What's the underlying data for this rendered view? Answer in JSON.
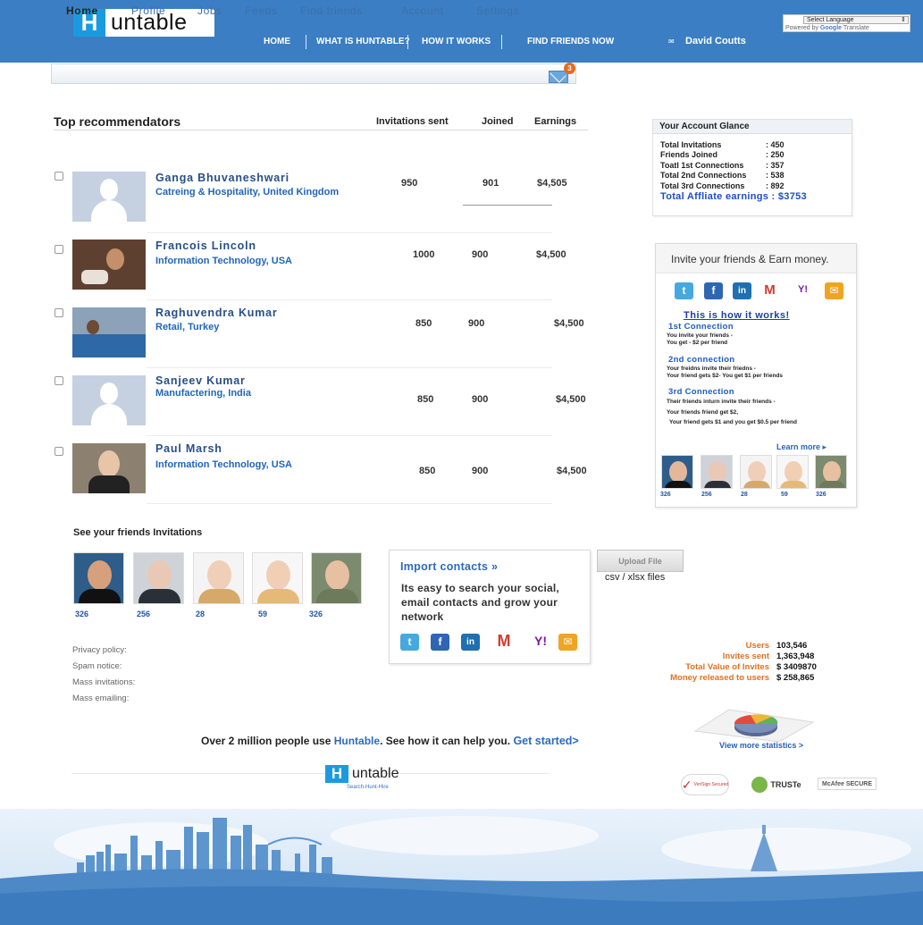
{
  "brand": {
    "logo_letter": "H",
    "logo_word": "untable",
    "footer_sub": "Search-Hunt-Hire"
  },
  "topnav": {
    "home": "HOME",
    "what": "WHAT IS HUNTABLE?",
    "how": "HOW IT WORKS",
    "find": "FIND FRIENDS NOW",
    "user": "David Coutts"
  },
  "language": {
    "select": "Select Language",
    "powered_prefix": "Powered by",
    "powered_google": "Google",
    "powered_suffix": "Translate"
  },
  "subnav": {
    "home": "Home",
    "profile": "Profile",
    "jobs": "Jobs",
    "feeds": "Feeds",
    "find_friends": "Find friends",
    "account": "Account",
    "settings": "Settings",
    "mail_count": "3"
  },
  "recommenders": {
    "title": "Top recommendators",
    "col_invitations": "Invitations sent",
    "col_joined": "Joined",
    "col_earnings": "Earnings",
    "rows": [
      {
        "name": "Ganga Bhuvaneshwari",
        "location": "Catreing & Hospitality, United Kingdom",
        "invitations": "950",
        "joined": "901",
        "earnings": "$4,505"
      },
      {
        "name": "Francois Lincoln",
        "location": "Information Technology, USA",
        "invitations": "1000",
        "joined": "900",
        "earnings": "$4,500"
      },
      {
        "name": "Raghuvendra Kumar",
        "location": "Retail, Turkey",
        "invitations": "850",
        "joined": "900",
        "earnings": "$4,500"
      },
      {
        "name": "Sanjeev Kumar",
        "location": "Manufactering, India",
        "invitations": "850",
        "joined": "900",
        "earnings": "$4,500"
      },
      {
        "name": "Paul Marsh",
        "location": "Information Technology, USA",
        "invitations": "850",
        "joined": "900",
        "earnings": "$4,500"
      }
    ]
  },
  "glance": {
    "title": "Your Account Glance",
    "items": [
      {
        "label": "Total Invitations",
        "value": ": 450"
      },
      {
        "label": "Friends Joined",
        "value": ": 250"
      },
      {
        "label": "Toatl 1st Connections",
        "value": ": 357"
      },
      {
        "label": "Total 2nd Connections",
        "value": ": 538"
      },
      {
        "label": "Total 3rd Connections",
        "value": ": 892"
      }
    ],
    "total": "Total Affliate earnings : $3753"
  },
  "invite": {
    "title": "Invite your friends & Earn money.",
    "how_link": "This is how it works!",
    "steps": [
      {
        "title": "1st Connection",
        "lines": [
          "You invite your friends -",
          "You get - $2 per friend"
        ]
      },
      {
        "title": "2nd connection",
        "lines": [
          "Your freidns invite their friedns -",
          "Your friend gets $2- You get $1 per friends"
        ]
      },
      {
        "title": "3rd Connection",
        "lines": [
          "Their friends inturn invite their friends -",
          "Your friends friend get $2,",
          "Your friend gets $1 and you get $0.5 per friend"
        ]
      }
    ],
    "learn_more": "Learn more ▸",
    "thumb_counts": [
      "326",
      "256",
      "28",
      "59",
      "326"
    ]
  },
  "friends_invitations": {
    "title": "See your friends Invitations",
    "counts": [
      "326",
      "256",
      "28",
      "59",
      "326"
    ]
  },
  "import": {
    "title": "Import contacts »",
    "desc": "Its easy to search your social, email contacts and grow your network",
    "upload": "Upload File",
    "note": "csv / xlsx files"
  },
  "footer_links": [
    "Privacy policy:",
    "Spam notice:",
    "Mass invitations:",
    "Mass emailing:"
  ],
  "stats": {
    "items": [
      {
        "label": "Users",
        "value": "103,546"
      },
      {
        "label": "Invites sent",
        "value": "1,363,948"
      },
      {
        "label": "Total Value of Invites",
        "value": "$ 3409870"
      },
      {
        "label": "Money released to users",
        "value": "$ 258,865"
      }
    ],
    "link": "View more statistics >"
  },
  "tagline": {
    "prefix": "Over 2 million people use ",
    "brand": "Huntable",
    "suffix": ". See how it can help you. ",
    "cta": "Get started>"
  },
  "badges": {
    "verisign": "VeriSign Secured",
    "truste": "TRUSTe",
    "mcafee": "McAfee SECURE"
  },
  "colors": {
    "header_blue": "#3b7ec3",
    "link_blue": "#2a6bbf",
    "accent_orange": "#e0711f"
  }
}
